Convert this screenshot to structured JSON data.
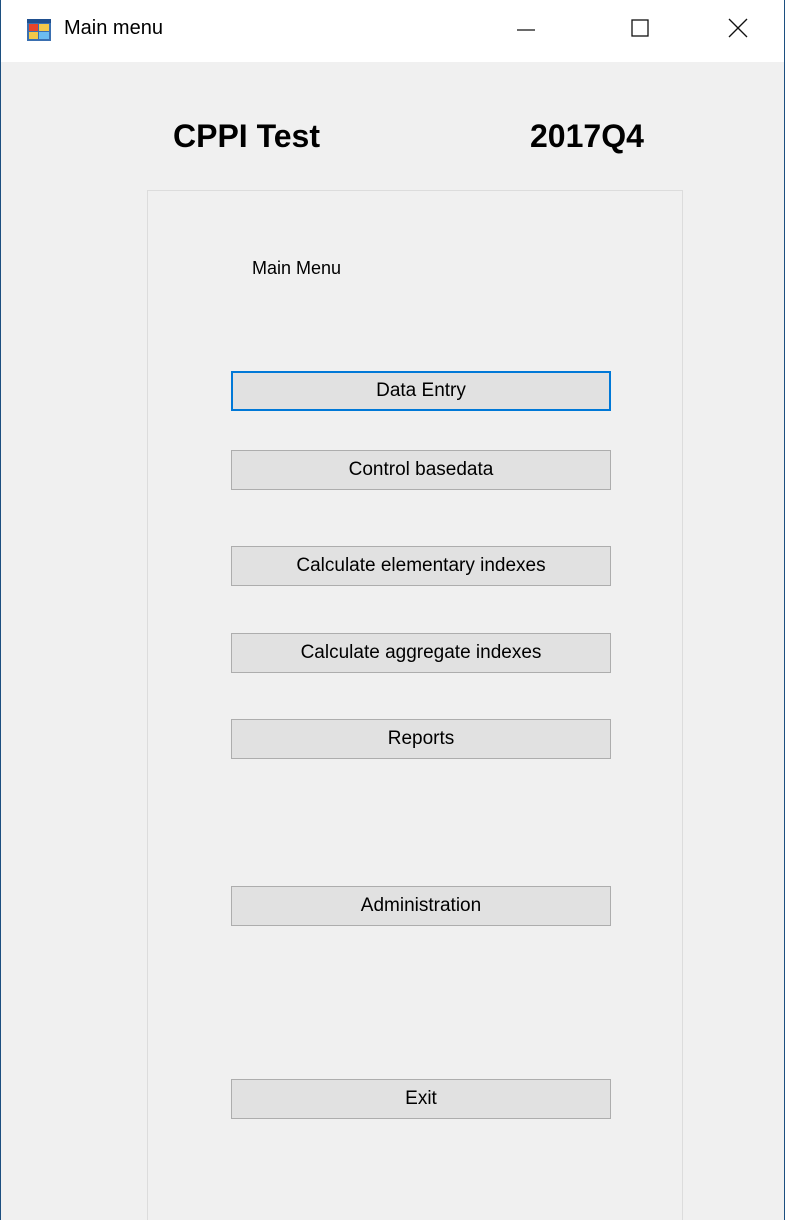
{
  "window": {
    "title": "Main menu",
    "icon": "app-icon",
    "controls": [
      "minimize-icon",
      "maximize-icon",
      "close-icon"
    ]
  },
  "header": {
    "title": "CPPI Test",
    "period": "2017Q4"
  },
  "menu": {
    "label": "Main Menu",
    "buttons": [
      {
        "label": "Data Entry",
        "focused": true
      },
      {
        "label": "Control basedata"
      },
      {
        "label": "Calculate elementary indexes"
      },
      {
        "label": "Calculate aggregate indexes"
      },
      {
        "label": "Reports"
      },
      {
        "label": "Administration"
      },
      {
        "label": "Exit"
      }
    ]
  },
  "colors": {
    "focus_border": "#0078d7",
    "button_face": "#e1e1e1",
    "window_background": "#f0f0f0"
  }
}
